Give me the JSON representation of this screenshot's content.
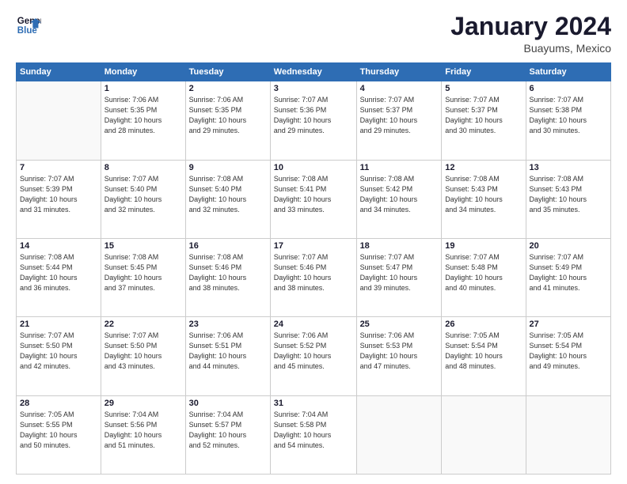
{
  "header": {
    "logo_line1": "General",
    "logo_line2": "Blue",
    "month_year": "January 2024",
    "location": "Buayums, Mexico"
  },
  "weekdays": [
    "Sunday",
    "Monday",
    "Tuesday",
    "Wednesday",
    "Thursday",
    "Friday",
    "Saturday"
  ],
  "weeks": [
    [
      {
        "day": "",
        "info": ""
      },
      {
        "day": "1",
        "info": "Sunrise: 7:06 AM\nSunset: 5:35 PM\nDaylight: 10 hours\nand 28 minutes."
      },
      {
        "day": "2",
        "info": "Sunrise: 7:06 AM\nSunset: 5:35 PM\nDaylight: 10 hours\nand 29 minutes."
      },
      {
        "day": "3",
        "info": "Sunrise: 7:07 AM\nSunset: 5:36 PM\nDaylight: 10 hours\nand 29 minutes."
      },
      {
        "day": "4",
        "info": "Sunrise: 7:07 AM\nSunset: 5:37 PM\nDaylight: 10 hours\nand 29 minutes."
      },
      {
        "day": "5",
        "info": "Sunrise: 7:07 AM\nSunset: 5:37 PM\nDaylight: 10 hours\nand 30 minutes."
      },
      {
        "day": "6",
        "info": "Sunrise: 7:07 AM\nSunset: 5:38 PM\nDaylight: 10 hours\nand 30 minutes."
      }
    ],
    [
      {
        "day": "7",
        "info": "Sunrise: 7:07 AM\nSunset: 5:39 PM\nDaylight: 10 hours\nand 31 minutes."
      },
      {
        "day": "8",
        "info": "Sunrise: 7:07 AM\nSunset: 5:40 PM\nDaylight: 10 hours\nand 32 minutes."
      },
      {
        "day": "9",
        "info": "Sunrise: 7:08 AM\nSunset: 5:40 PM\nDaylight: 10 hours\nand 32 minutes."
      },
      {
        "day": "10",
        "info": "Sunrise: 7:08 AM\nSunset: 5:41 PM\nDaylight: 10 hours\nand 33 minutes."
      },
      {
        "day": "11",
        "info": "Sunrise: 7:08 AM\nSunset: 5:42 PM\nDaylight: 10 hours\nand 34 minutes."
      },
      {
        "day": "12",
        "info": "Sunrise: 7:08 AM\nSunset: 5:43 PM\nDaylight: 10 hours\nand 34 minutes."
      },
      {
        "day": "13",
        "info": "Sunrise: 7:08 AM\nSunset: 5:43 PM\nDaylight: 10 hours\nand 35 minutes."
      }
    ],
    [
      {
        "day": "14",
        "info": "Sunrise: 7:08 AM\nSunset: 5:44 PM\nDaylight: 10 hours\nand 36 minutes."
      },
      {
        "day": "15",
        "info": "Sunrise: 7:08 AM\nSunset: 5:45 PM\nDaylight: 10 hours\nand 37 minutes."
      },
      {
        "day": "16",
        "info": "Sunrise: 7:08 AM\nSunset: 5:46 PM\nDaylight: 10 hours\nand 38 minutes."
      },
      {
        "day": "17",
        "info": "Sunrise: 7:07 AM\nSunset: 5:46 PM\nDaylight: 10 hours\nand 38 minutes."
      },
      {
        "day": "18",
        "info": "Sunrise: 7:07 AM\nSunset: 5:47 PM\nDaylight: 10 hours\nand 39 minutes."
      },
      {
        "day": "19",
        "info": "Sunrise: 7:07 AM\nSunset: 5:48 PM\nDaylight: 10 hours\nand 40 minutes."
      },
      {
        "day": "20",
        "info": "Sunrise: 7:07 AM\nSunset: 5:49 PM\nDaylight: 10 hours\nand 41 minutes."
      }
    ],
    [
      {
        "day": "21",
        "info": "Sunrise: 7:07 AM\nSunset: 5:50 PM\nDaylight: 10 hours\nand 42 minutes."
      },
      {
        "day": "22",
        "info": "Sunrise: 7:07 AM\nSunset: 5:50 PM\nDaylight: 10 hours\nand 43 minutes."
      },
      {
        "day": "23",
        "info": "Sunrise: 7:06 AM\nSunset: 5:51 PM\nDaylight: 10 hours\nand 44 minutes."
      },
      {
        "day": "24",
        "info": "Sunrise: 7:06 AM\nSunset: 5:52 PM\nDaylight: 10 hours\nand 45 minutes."
      },
      {
        "day": "25",
        "info": "Sunrise: 7:06 AM\nSunset: 5:53 PM\nDaylight: 10 hours\nand 47 minutes."
      },
      {
        "day": "26",
        "info": "Sunrise: 7:05 AM\nSunset: 5:54 PM\nDaylight: 10 hours\nand 48 minutes."
      },
      {
        "day": "27",
        "info": "Sunrise: 7:05 AM\nSunset: 5:54 PM\nDaylight: 10 hours\nand 49 minutes."
      }
    ],
    [
      {
        "day": "28",
        "info": "Sunrise: 7:05 AM\nSunset: 5:55 PM\nDaylight: 10 hours\nand 50 minutes."
      },
      {
        "day": "29",
        "info": "Sunrise: 7:04 AM\nSunset: 5:56 PM\nDaylight: 10 hours\nand 51 minutes."
      },
      {
        "day": "30",
        "info": "Sunrise: 7:04 AM\nSunset: 5:57 PM\nDaylight: 10 hours\nand 52 minutes."
      },
      {
        "day": "31",
        "info": "Sunrise: 7:04 AM\nSunset: 5:58 PM\nDaylight: 10 hours\nand 54 minutes."
      },
      {
        "day": "",
        "info": ""
      },
      {
        "day": "",
        "info": ""
      },
      {
        "day": "",
        "info": ""
      }
    ]
  ]
}
